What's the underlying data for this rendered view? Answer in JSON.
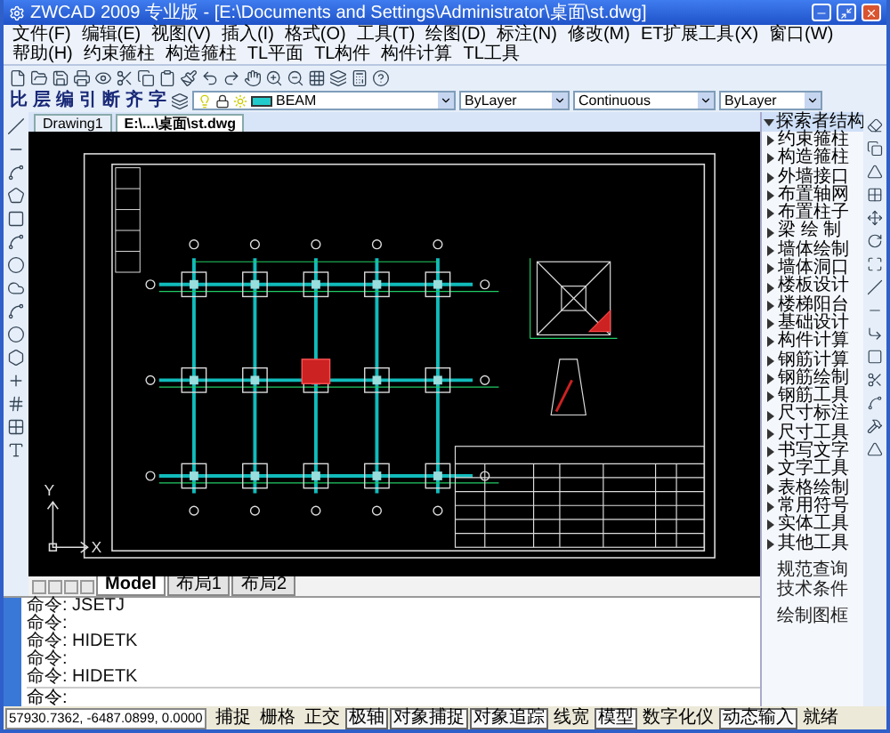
{
  "window": {
    "title": "ZWCAD 2009 专业版 - [E:\\Documents and Settings\\Administrator\\桌面\\st.dwg]"
  },
  "menu": [
    "文件(F)",
    "编辑(E)",
    "视图(V)",
    "插入(I)",
    "格式(O)",
    "工具(T)",
    "绘图(D)",
    "标注(N)",
    "修改(M)",
    "ET扩展工具(X)",
    "窗口(W)",
    "帮助(H)",
    "约束箍柱",
    "构造箍柱",
    "TL平面",
    "TL构件",
    "构件计算",
    "TL工具"
  ],
  "text_tools": [
    "比",
    "层",
    "编",
    "引",
    "断",
    "齐",
    "字"
  ],
  "layer": {
    "value": "BEAM"
  },
  "color": {
    "value": "ByLayer"
  },
  "linetype": {
    "value": "Continuous"
  },
  "lineweight": {
    "value": "ByLayer"
  },
  "documents": [
    {
      "label": "Drawing1",
      "selected": false
    },
    {
      "label": "E:\\...\\桌面\\st.dwg",
      "selected": true
    }
  ],
  "ucs": {
    "x_label": "X",
    "y_label": "Y"
  },
  "layout_tabs": [
    {
      "label": "Model",
      "selected": true
    },
    {
      "label": "布局1",
      "selected": false
    },
    {
      "label": "布局2",
      "selected": false
    }
  ],
  "command": {
    "history": [
      "命令: JSETJ",
      "命令:",
      "命令: HIDETK",
      "命令:",
      "命令: HIDETK"
    ],
    "prompt": "命令:"
  },
  "panel": {
    "title": "探索者结构",
    "expanded": true,
    "items": [
      "约束箍柱",
      "构造箍柱",
      "外墙接口",
      "布置轴网",
      "布置柱子",
      "梁 绘 制",
      "墙体绘制",
      "墙体洞口",
      "楼板设计",
      "楼梯阳台",
      "基础设计",
      "构件计算",
      "钢筋计算",
      "钢筋绘制",
      "钢筋工具",
      "尺寸标注",
      "尺寸工具",
      "书写文字",
      "文字工具",
      "表格绘制",
      "常用符号",
      "实体工具",
      "其他工具"
    ],
    "links": [
      "规范查询",
      "技术条件"
    ],
    "footer": "绘制图框"
  },
  "status": {
    "coordinates": "57930.7362, -6487.0899, 0.0000",
    "toggles": [
      {
        "label": "捕捉",
        "on": false
      },
      {
        "label": "栅格",
        "on": false
      },
      {
        "label": "正交",
        "on": false
      },
      {
        "label": "极轴",
        "on": true
      },
      {
        "label": "对象捕捉",
        "on": true
      },
      {
        "label": "对象追踪",
        "on": true
      },
      {
        "label": "线宽",
        "on": false
      },
      {
        "label": "模型",
        "on": true
      },
      {
        "label": "数字化仪",
        "on": false
      },
      {
        "label": "动态输入",
        "on": true
      },
      {
        "label": "就绪",
        "on": false
      }
    ]
  }
}
